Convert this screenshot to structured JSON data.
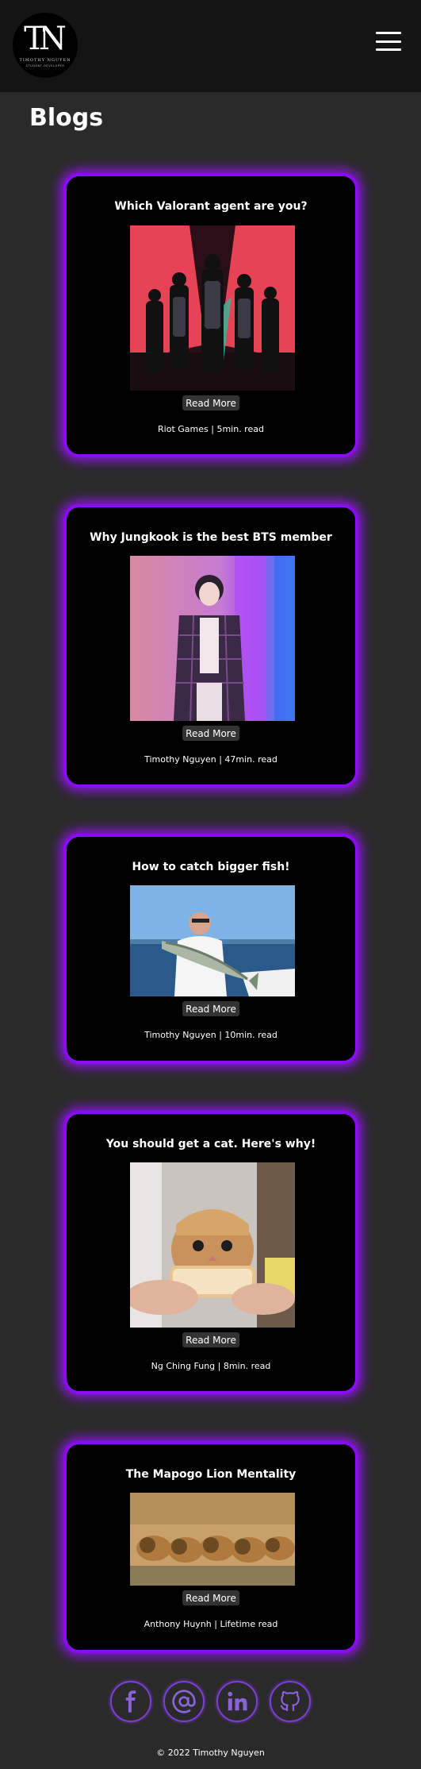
{
  "header": {
    "logo_mark": "TN",
    "logo_name": "TIMOTHY NGUYEN",
    "logo_subtitle": "STUDENT DEVELOPER"
  },
  "page": {
    "title": "Blogs"
  },
  "blogs": [
    {
      "title": "Which Valorant agent are you?",
      "read_more": "Read More",
      "meta": "Riot Games | 5min. read"
    },
    {
      "title": "Why Jungkook is the best BTS member",
      "read_more": "Read More",
      "meta": "Timothy Nguyen | 47min. read"
    },
    {
      "title": "How to catch bigger fish!",
      "read_more": "Read More",
      "meta": "Timothy Nguyen | 10min. read"
    },
    {
      "title": "You should get a cat. Here's why!",
      "read_more": "Read More",
      "meta": "Ng Ching Fung | 8min. read"
    },
    {
      "title": "The Mapogo Lion Mentality",
      "read_more": "Read More",
      "meta": "Anthony Huynh | Lifetime read"
    }
  ],
  "socials": {
    "facebook": "facebook-icon",
    "email": "at-sign-icon",
    "linkedin": "linkedin-icon",
    "github": "github-icon"
  },
  "footer": {
    "copyright": "© 2022 Timothy Nguyen"
  },
  "colors": {
    "accent": "#8a0cf5",
    "background": "#2a2a2a",
    "header": "#141414",
    "card": "#000000"
  }
}
